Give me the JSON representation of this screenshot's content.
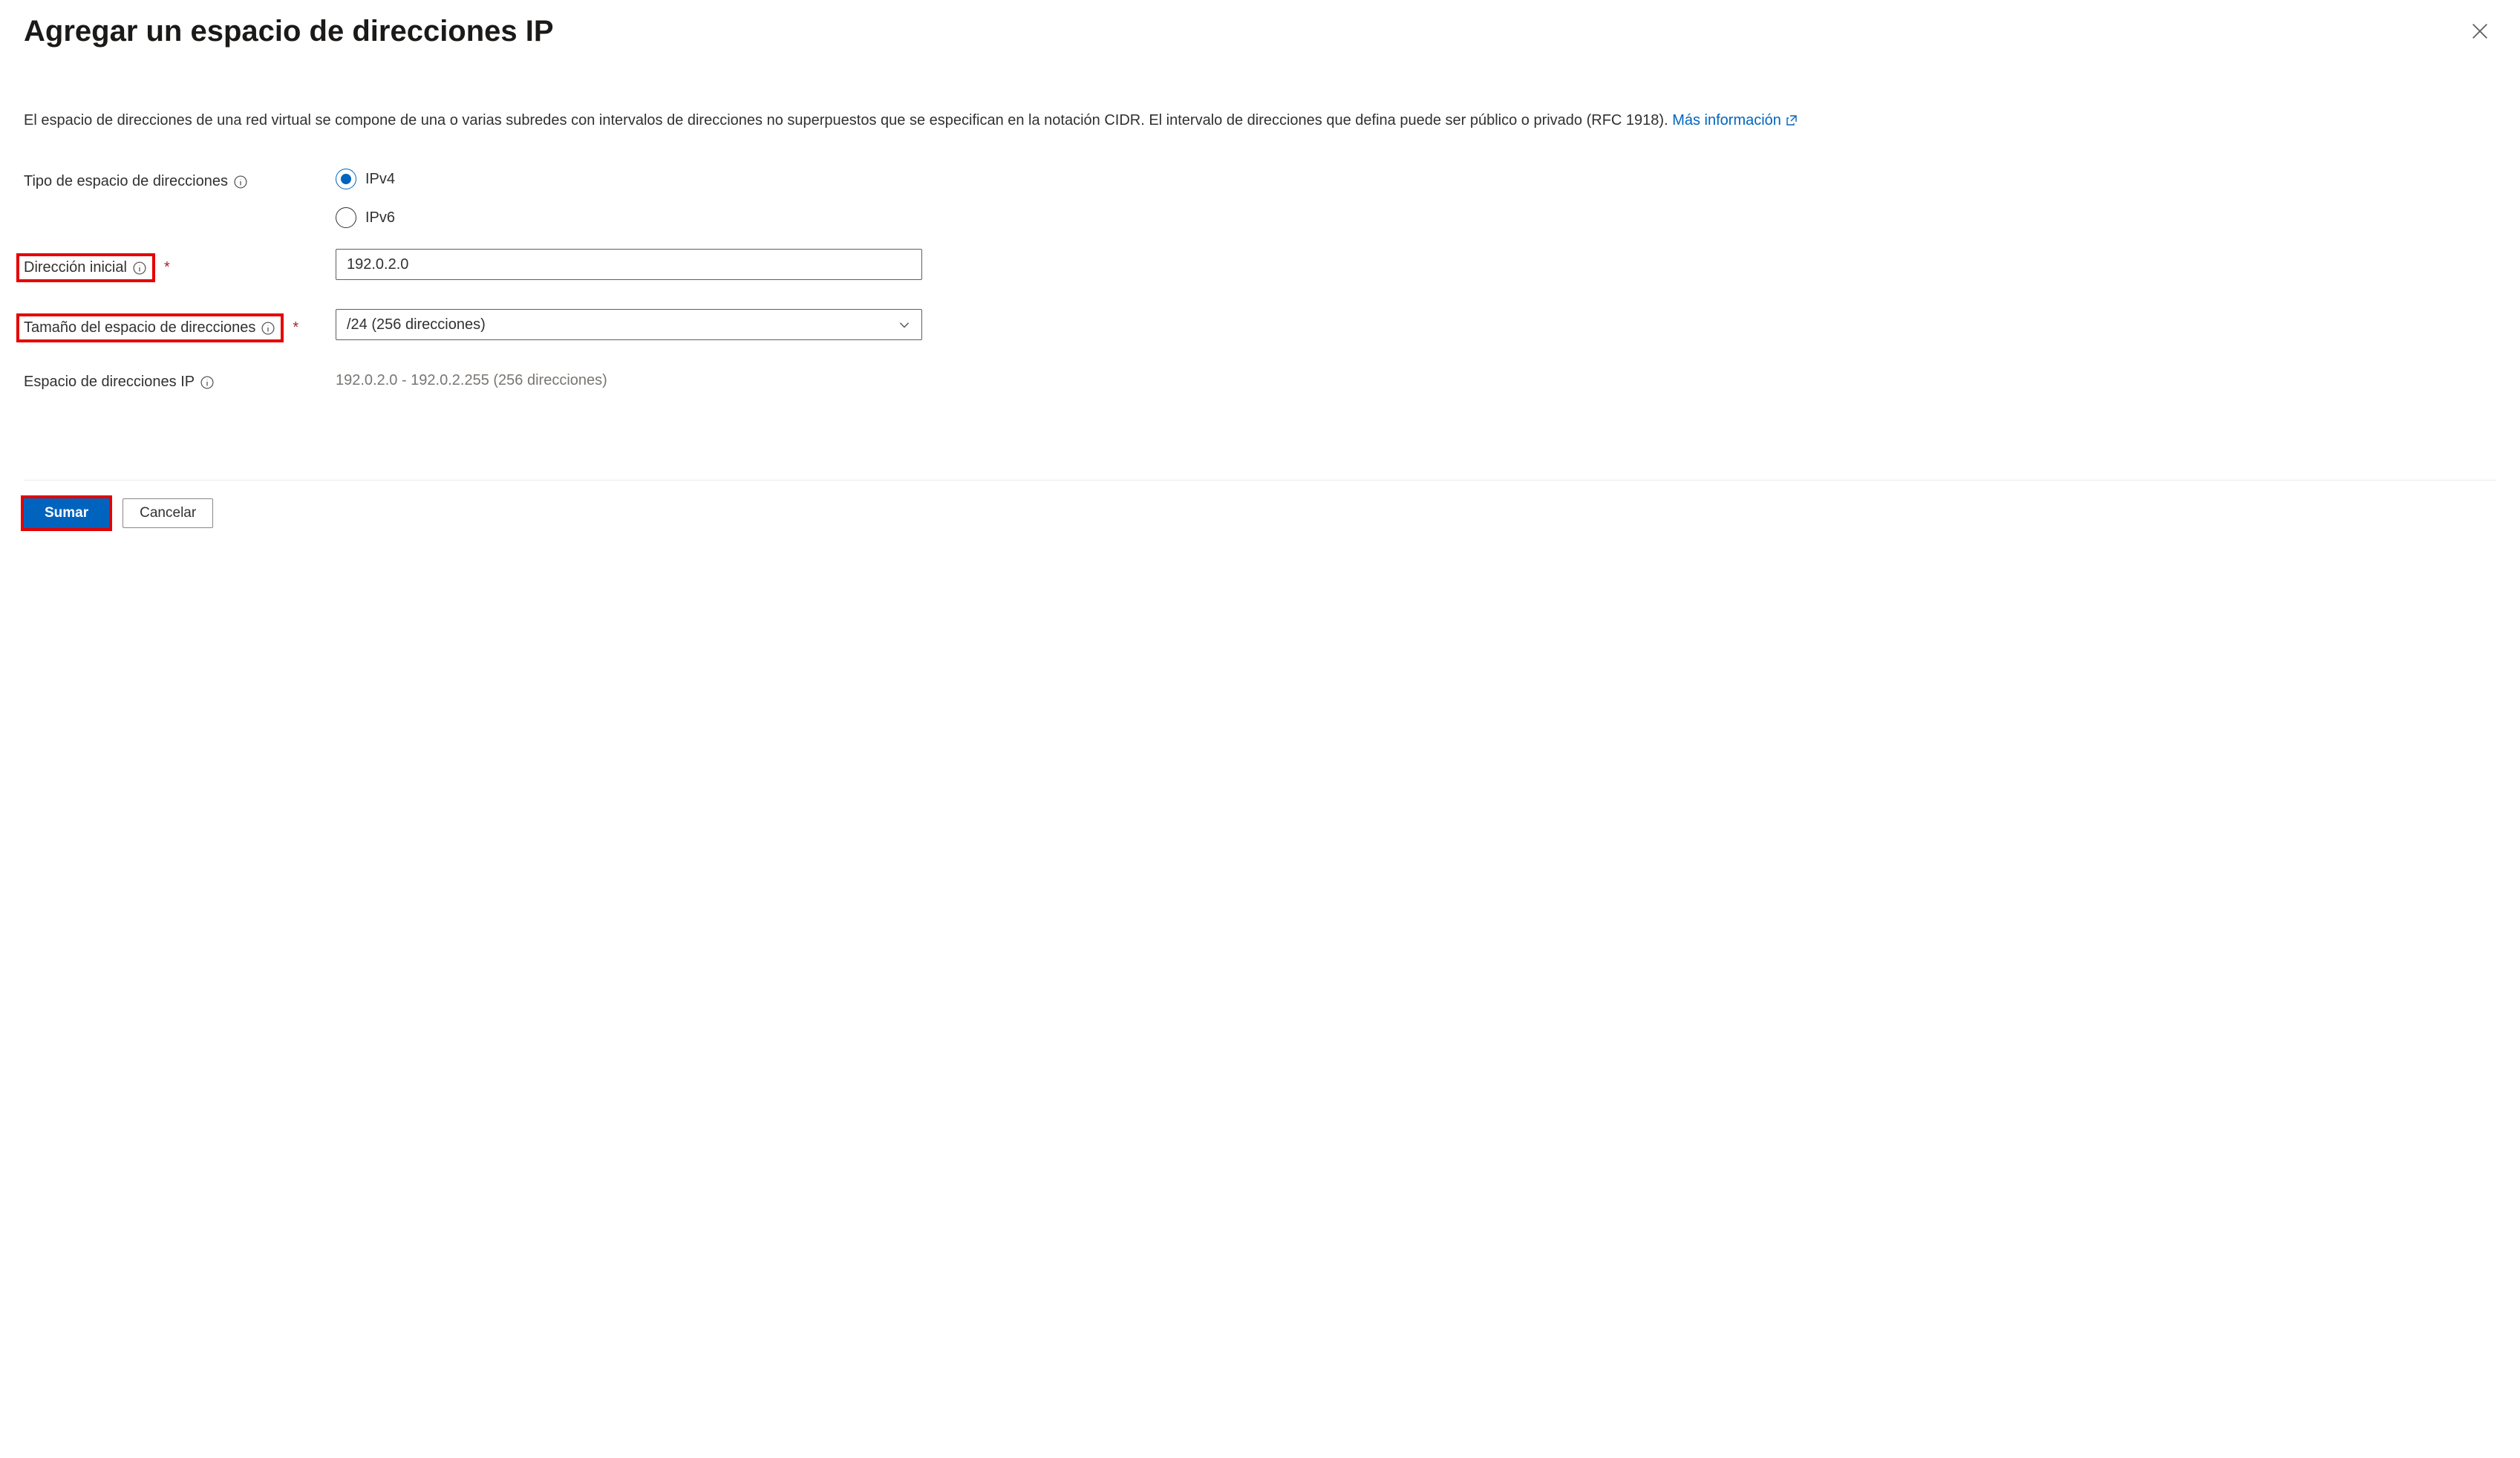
{
  "header": {
    "title": "Agregar un espacio de direcciones IP"
  },
  "description": {
    "text": "El espacio de direcciones de una red virtual se compone de una o varias subredes con intervalos de direcciones no superpuestos que se especifican en la notación CIDR. El intervalo de direcciones que defina puede ser público o privado (RFC 1918). ",
    "link_text": "Más información"
  },
  "fields": {
    "address_type": {
      "label": "Tipo de espacio de direcciones",
      "options": {
        "ipv4": "IPv4",
        "ipv6": "IPv6"
      },
      "selected": "ipv4"
    },
    "start_address": {
      "label": "Dirección inicial",
      "value": "192.0.2.0"
    },
    "address_size": {
      "label": "Tamaño del espacio de direcciones",
      "value": "/24 (256 direcciones)"
    },
    "ip_space": {
      "label": "Espacio de direcciones IP",
      "value": "192.0.2.0 - 192.0.2.255 (256 direcciones)"
    }
  },
  "footer": {
    "add": "Sumar",
    "cancel": "Cancelar"
  }
}
